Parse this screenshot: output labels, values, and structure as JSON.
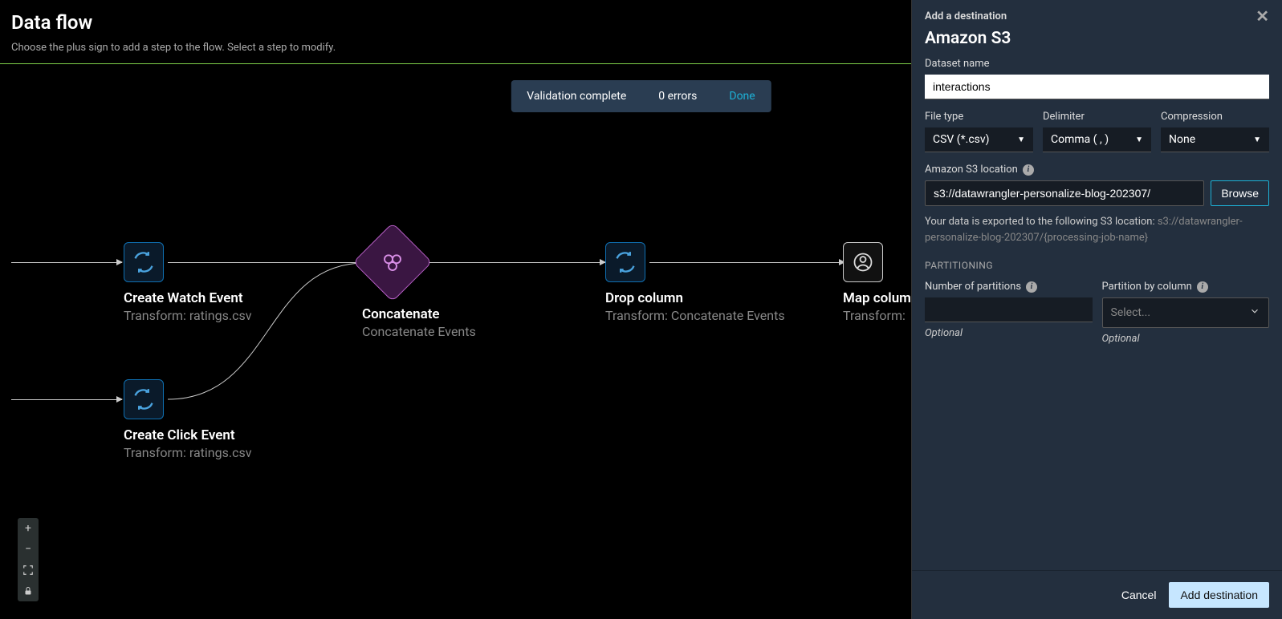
{
  "header": {
    "title": "Data flow",
    "subtitle": "Choose the plus sign to add a step to the flow. Select a step to modify."
  },
  "toast": {
    "status": "Validation complete",
    "errors": "0 errors",
    "done": "Done"
  },
  "nodes": {
    "watch": {
      "title": "Create Watch Event",
      "sub": "Transform: ratings.csv"
    },
    "click": {
      "title": "Create Click Event",
      "sub": "Transform: ratings.csv"
    },
    "concat": {
      "title": "Concatenate",
      "sub": "Concatenate Events"
    },
    "drop": {
      "title": "Drop column",
      "sub": "Transform: Concatenate Events"
    },
    "map": {
      "title": "Map column",
      "sub": "Transform: "
    }
  },
  "panel": {
    "crumb": "Add a destination",
    "title": "Amazon S3",
    "dataset_name_label": "Dataset name",
    "dataset_name_value": "interactions",
    "filetype_label": "File type",
    "filetype_value": "CSV (*.csv)",
    "delimiter_label": "Delimiter",
    "delimiter_value": "Comma ( , )",
    "compression_label": "Compression",
    "compression_value": "None",
    "s3_label": "Amazon S3 location",
    "s3_value": "s3://datawrangler-personalize-blog-202307/",
    "browse": "Browse",
    "helper_prefix": "Your data is exported to the following S3 location: ",
    "helper_path": "s3://datawrangler-personalize-blog-202307/{processing-job-name}",
    "partitioning": "PARTITIONING",
    "num_partitions_label": "Number of partitions",
    "partition_col_label": "Partition by column",
    "partition_col_placeholder": "Select...",
    "optional": "Optional",
    "cancel": "Cancel",
    "add": "Add destination"
  }
}
